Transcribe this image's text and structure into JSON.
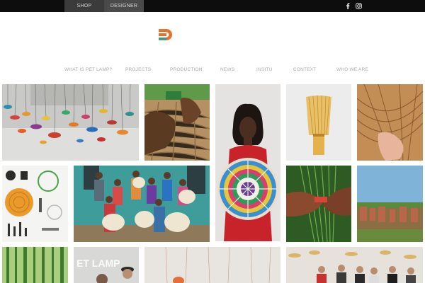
{
  "topbar": {
    "tabs": [
      {
        "label": "SHOP"
      },
      {
        "label": "DESIGNER"
      }
    ],
    "social": [
      {
        "icon": "facebook-icon"
      },
      {
        "icon": "instagram-icon"
      }
    ]
  },
  "logo": {
    "icon": "petlamp-logo-icon",
    "colors": [
      "#e8702a",
      "#3fa083"
    ]
  },
  "nav": {
    "items": [
      {
        "label": "WHAT IS PET LAMP?"
      },
      {
        "label": "PROJECTS"
      },
      {
        "label": "PRODUCTION"
      },
      {
        "label": "NEWS"
      },
      {
        "label": "INSITU"
      },
      {
        "label": "CONTEXT"
      },
      {
        "label": "WHO WE ARE"
      }
    ]
  },
  "gallery": {
    "tiles": [
      {
        "subject": "hanging-lamps-installation"
      },
      {
        "subject": "hands-weaving-basket"
      },
      {
        "subject": "woman-with-woven-plate"
      },
      {
        "subject": "bamboo-whisk-lamp"
      },
      {
        "subject": "hand-on-wicker-weave"
      },
      {
        "subject": "lamp-parts-layout"
      },
      {
        "subject": "weaver-group-photo"
      },
      {
        "subject": "hands-with-green-fibers"
      },
      {
        "subject": "fields-with-drying-fibers"
      },
      {
        "subject": "bamboo-forest"
      },
      {
        "subject": "pet-lamp-sign-people"
      },
      {
        "subject": "lamp-cables-room"
      },
      {
        "subject": "team-under-lamps"
      }
    ]
  }
}
